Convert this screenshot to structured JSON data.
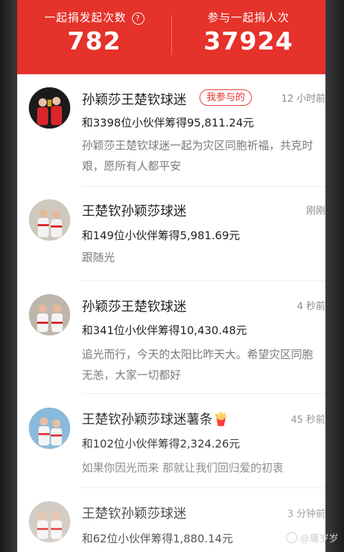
{
  "stats": {
    "left_label": "一起捐发起次数",
    "left_help_icon": "?",
    "left_value": "782",
    "right_label": "参与一起捐人次",
    "right_value": "37924"
  },
  "feed": [
    {
      "name": "孙颖莎王楚钦球迷",
      "badge": "我参与的",
      "time": "12 小时前",
      "summary": "和3398位小伙伴筹得95,811.24元",
      "message": "孙颖莎王楚钦球迷一起为灾区同胞祈福，共克时艰，愿所有人都平安"
    },
    {
      "name": "王楚钦孙颖莎球迷",
      "time": "刚刚",
      "summary": "和149位小伙伴筹得5,981.69元",
      "message": "跟随光"
    },
    {
      "name": "孙颖莎王楚钦球迷",
      "time": "4 秒前",
      "summary": "和341位小伙伴筹得10,430.48元",
      "message": "追光而行，今天的太阳比昨天大。希望灾区同胞无恙，大家一切都好"
    },
    {
      "name": "王楚钦孙颖莎球迷薯条🍟",
      "time": "45 秒前",
      "summary": "和102位小伙伴筹得2,324.26元",
      "message": "如果你因光而来 那就让我们回归爱的初衷"
    },
    {
      "name": "王楚钦孙颖莎球迷",
      "time": "3 分钟前",
      "summary": "和62位小伙伴筹得1,880.14元",
      "message": ""
    }
  ],
  "watermark": "@庸岁岁",
  "colors": {
    "accent": "#e5322a",
    "muted": "#8a8a8a"
  }
}
